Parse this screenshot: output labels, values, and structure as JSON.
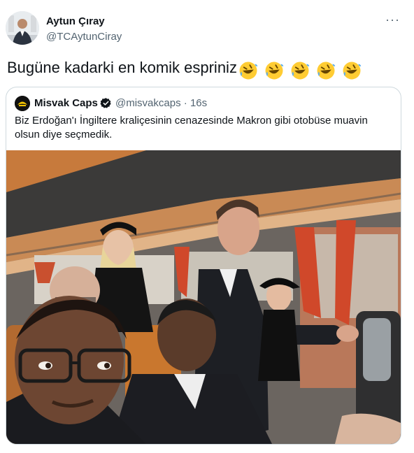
{
  "author": {
    "name": "Aytun Çıray",
    "handle": "@TCAytunCiray",
    "avatar_icon": "profile-photo"
  },
  "more_icon": "more-options-icon",
  "tweet": {
    "text": "Bugüne kadarki en komik espriniz",
    "emoji": [
      "rolling-on-floor-laughing",
      "rolling-on-floor-laughing",
      "rolling-on-floor-laughing",
      "rolling-on-floor-laughing",
      "rolling-on-floor-laughing"
    ]
  },
  "quoted": {
    "name": "Misvak Caps",
    "verified": true,
    "handle": "@misvakcaps",
    "separator": "·",
    "time": "16s",
    "text": "Biz Erdoğan'ı İngiltere kraliçesinin cenazesinde Makron gibi otobüse muavin olsun diye seçmedik.",
    "media": "photo-bus-interior-passengers"
  },
  "colors": {
    "text": "#0f1419",
    "secondary": "#536471",
    "border": "#cfd9de",
    "verified": "#1d9bf0"
  }
}
